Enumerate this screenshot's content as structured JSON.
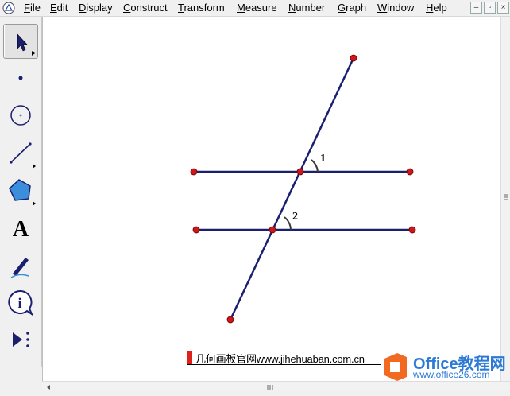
{
  "menu": [
    "File",
    "Edit",
    "Display",
    "Construct",
    "Transform",
    "Measure",
    "Number",
    "Graph",
    "Window",
    "Help"
  ],
  "window_buttons": [
    "–",
    "▫",
    "×"
  ],
  "toolbox": [
    {
      "name": "arrow-tool",
      "active": true,
      "submenu": true
    },
    {
      "name": "point-tool",
      "active": false,
      "submenu": false
    },
    {
      "name": "compass-tool",
      "active": false,
      "submenu": false
    },
    {
      "name": "straightedge-tool",
      "active": false,
      "submenu": true
    },
    {
      "name": "polygon-tool",
      "active": false,
      "submenu": true
    },
    {
      "name": "text-tool",
      "active": false,
      "submenu": false
    },
    {
      "name": "marker-tool",
      "active": false,
      "submenu": false
    },
    {
      "name": "information-tool",
      "active": false,
      "submenu": false
    },
    {
      "name": "custom-tool",
      "active": false,
      "submenu": false
    }
  ],
  "text_tool_glyph": "A",
  "figure": {
    "line_color": "#1a1f6e",
    "point_color": "#d0151b",
    "angle_labels": [
      "1",
      "2"
    ]
  },
  "caption": "几何画板官网www.jihehuaban.com.cn",
  "watermark": {
    "main": "Office教程网",
    "sub": "www.office26.com"
  }
}
